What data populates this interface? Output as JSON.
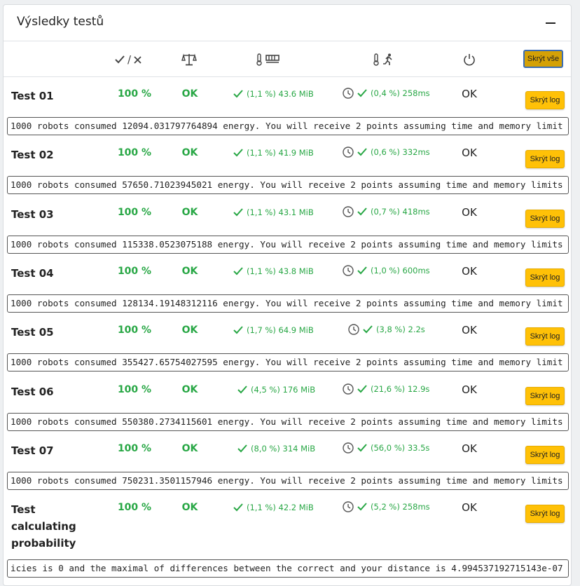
{
  "card": {
    "title": "Výsledky testů"
  },
  "header": {
    "correct_wrong_label": "/",
    "hide_all_label": "Skrýt vše",
    "icons": [
      "check-cross-icon",
      "scales-icon",
      "thermometer-memory-icon",
      "thermometer-runner-icon",
      "power-icon"
    ]
  },
  "colors": {
    "success": "#28a745",
    "button": "#ffc107",
    "hide_all": "#d4a106"
  },
  "rows": [
    {
      "name": "Test 01",
      "pct": "100 %",
      "verdict": "OK",
      "mem": "(1,1 %) 43.6 MiB",
      "time": "(0,4 %) 258ms",
      "exit": "OK",
      "btn": "Skrýt log",
      "log": "1000 robots consumed 12094.031797764894 energy. You will receive 2 points assuming time and memory limit"
    },
    {
      "name": "Test 02",
      "pct": "100 %",
      "verdict": "OK",
      "mem": "(1,1 %) 41.9 MiB",
      "time": "(0,6 %) 332ms",
      "exit": "OK",
      "btn": "Skrýt log",
      "log": "1000 robots consumed 57650.71023945021 energy. You will receive 2 points assuming time and memory limits"
    },
    {
      "name": "Test 03",
      "pct": "100 %",
      "verdict": "OK",
      "mem": "(1,1 %) 43.1 MiB",
      "time": "(0,7 %) 418ms",
      "exit": "OK",
      "btn": "Skrýt log",
      "log": "1000 robots consumed 115338.0523075188 energy. You will receive 2 points assuming time and memory limits"
    },
    {
      "name": "Test 04",
      "pct": "100 %",
      "verdict": "OK",
      "mem": "(1,1 %) 43.8 MiB",
      "time": "(1,0 %) 600ms",
      "exit": "OK",
      "btn": "Skrýt log",
      "log": "1000 robots consumed 128134.19148312116 energy. You will receive 2 points assuming time and memory limit"
    },
    {
      "name": "Test 05",
      "pct": "100 %",
      "verdict": "OK",
      "mem": "(1,7 %) 64.9 MiB",
      "time": "(3,8 %) 2.2s",
      "exit": "OK",
      "btn": "Skrýt log",
      "log": "1000 robots consumed 355427.65754027595 energy. You will receive 2 points assuming time and memory limit"
    },
    {
      "name": "Test 06",
      "pct": "100 %",
      "verdict": "OK",
      "mem": "(4,5 %) 176 MiB",
      "time": "(21,6 %) 12.9s",
      "exit": "OK",
      "btn": "Skrýt log",
      "log": "1000 robots consumed 550380.2734115601 energy. You will receive 2 points assuming time and memory limits"
    },
    {
      "name": "Test 07",
      "pct": "100 %",
      "verdict": "OK",
      "mem": "(8,0 %) 314 MiB",
      "time": "(56,0 %) 33.5s",
      "exit": "OK",
      "btn": "Skrýt log",
      "log": "1000 robots consumed 750231.3501157946 energy. You will receive 2 points assuming time and memory limits"
    },
    {
      "name": "Test calculating probability",
      "pct": "100 %",
      "verdict": "OK",
      "mem": "(1,1 %) 42.2 MiB",
      "time": "(5,2 %) 258ms",
      "exit": "OK",
      "btn": "Skrýt log",
      "log": "icies is 0 and the maximal of differences between the correct and your distance is 4.994537192715143e-07"
    }
  ]
}
